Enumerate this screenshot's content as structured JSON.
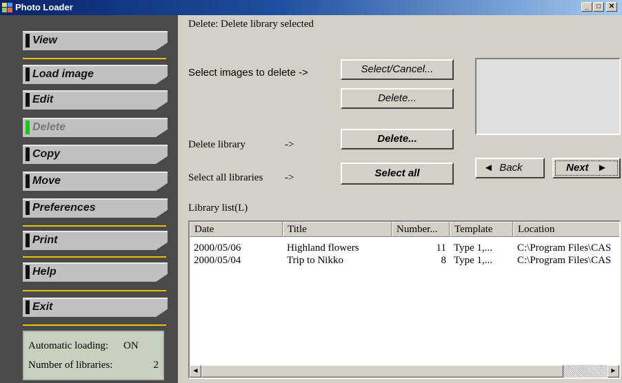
{
  "window": {
    "title": "Photo Loader"
  },
  "menu": {
    "view": "View",
    "load_image": "Load image",
    "edit": "Edit",
    "delete": "Delete",
    "copy": "Copy",
    "move": "Move",
    "preferences": "Preferences",
    "print": "Print",
    "help": "Help",
    "exit": "Exit"
  },
  "status": {
    "auto_loading_label": "Automatic loading:",
    "auto_loading_value": "ON",
    "num_libraries_label": "Number of libraries:",
    "num_libraries_value": "2"
  },
  "main": {
    "mode_text": "Delete: Delete library selected",
    "select_images_label": "Select images to delete  ->",
    "select_cancel_button": "Select/Cancel...",
    "delete_images_button": "Delete...",
    "delete_library_label": "Delete library",
    "delete_library_arrow": "->",
    "delete_library_button": "Delete...",
    "select_all_label": "Select all libraries",
    "select_all_arrow": "->",
    "select_all_button": "Select all",
    "back_button": "Back",
    "next_button": "Next",
    "library_list_label": "Library list(L)"
  },
  "library_list": {
    "columns": [
      "Date",
      "Title",
      "Number...",
      "Template",
      "Location"
    ],
    "rows": [
      {
        "date": "2000/05/06",
        "title": "Highland flowers",
        "number": "11",
        "template": "Type 1,...",
        "location": "C:\\Program Files\\CAS"
      },
      {
        "date": "2000/05/04",
        "title": "Trip to Nikko",
        "number": "8",
        "template": "Type 1,...",
        "location": "C:\\Program Files\\CAS"
      }
    ]
  },
  "colors": {
    "titlebar": "#0a246a",
    "panel": "#4a4a4a",
    "separator": "#e5c300",
    "active_marker": "#1fc11f"
  },
  "icons": {
    "app": "photo-loader-icon",
    "minimize": "minimize-icon",
    "maximize": "maximize-icon",
    "close": "close-icon"
  }
}
